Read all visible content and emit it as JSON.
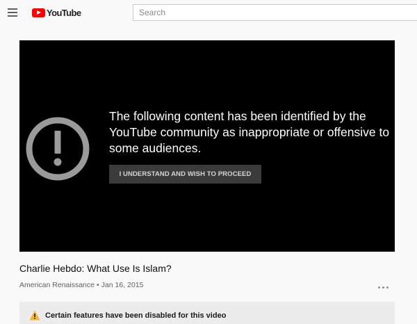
{
  "header": {
    "logo_text": "YouTube",
    "search_placeholder": "Search",
    "brand_color": "#ff0000"
  },
  "player": {
    "warning_icon": "exclamation-circle-icon",
    "message": "The following content has been identified by the YouTube community as inappropriate or offensive to some audiences.",
    "proceed_label": "I UNDERSTAND AND WISH TO PROCEED"
  },
  "video": {
    "title": "Charlie Hebdo: What Use Is Islam?",
    "channel": "American Renaissance",
    "separator": "•",
    "date": "Jan 16, 2015",
    "more_icon": "more-horizontal-icon"
  },
  "notice": {
    "icon": "warning-triangle-icon",
    "text": "Certain features have been disabled for this video"
  }
}
